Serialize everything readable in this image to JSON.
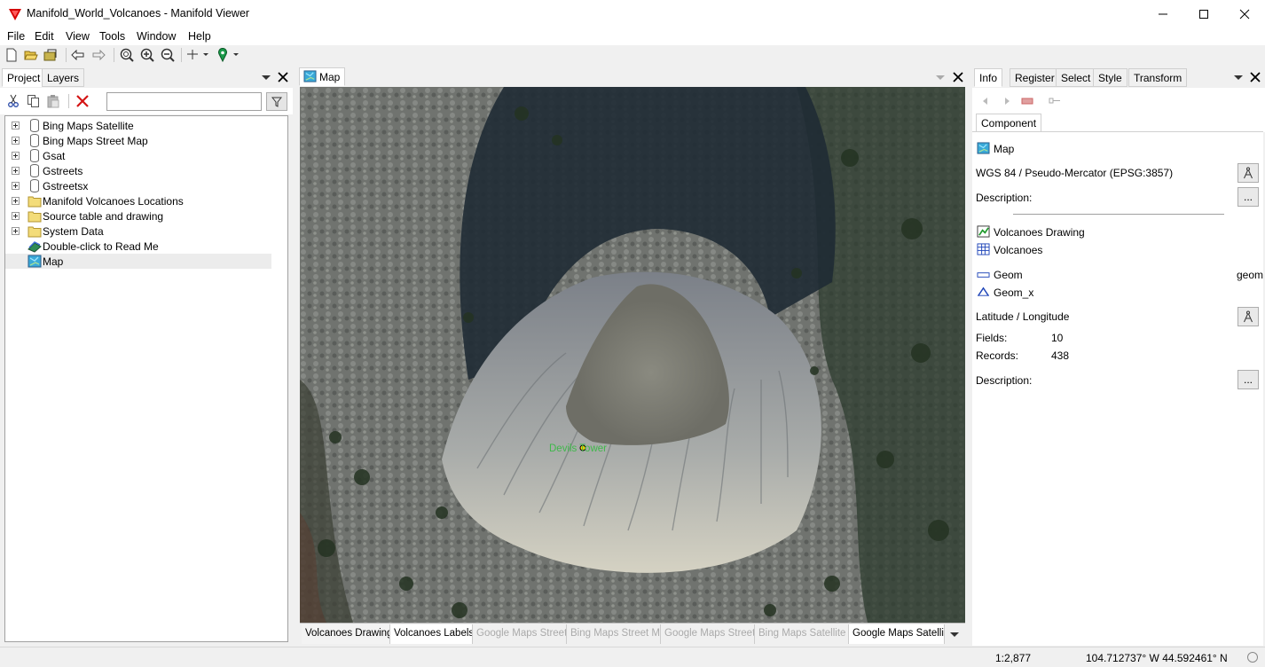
{
  "window": {
    "title": "Manifold_World_Volcanoes - Manifold Viewer",
    "accent": "#d40000"
  },
  "menu": [
    "File",
    "Edit",
    "View",
    "Tools",
    "Window",
    "Help"
  ],
  "toolbar_icons": [
    "new-icon",
    "open-icon",
    "save-icon",
    "back-icon",
    "forward-icon",
    "zoom-icon",
    "zoom-in-icon",
    "zoom-out-icon",
    "crosshair-icon",
    "locate-icon"
  ],
  "left_panel": {
    "tabs": [
      "Project",
      "Layers"
    ],
    "search_value": "",
    "tree": [
      {
        "label": "Bing Maps Satellite",
        "icon": "database-icon",
        "expandable": true
      },
      {
        "label": "Bing Maps Street Map",
        "icon": "database-icon",
        "expandable": true
      },
      {
        "label": "Gsat",
        "icon": "database-icon",
        "expandable": true
      },
      {
        "label": "Gstreets",
        "icon": "database-icon",
        "expandable": true
      },
      {
        "label": "Gstreetsx",
        "icon": "database-icon",
        "expandable": true
      },
      {
        "label": "Manifold Volcanoes Locations",
        "icon": "folder-icon",
        "expandable": true
      },
      {
        "label": "Source table and drawing",
        "icon": "folder-icon",
        "expandable": true
      },
      {
        "label": "System Data",
        "icon": "folder-icon",
        "expandable": true
      },
      {
        "label": "Double-click to Read Me",
        "icon": "comments-icon",
        "expandable": false
      },
      {
        "label": "Map",
        "icon": "map-icon",
        "expandable": false,
        "selected": true
      }
    ]
  },
  "map_window": {
    "tab": "Map",
    "feature_label": "Devils Tower",
    "layer_tabs": [
      {
        "label": "Volcanoes Drawing",
        "state": "mid"
      },
      {
        "label": "Volcanoes Labels",
        "state": "on"
      },
      {
        "label": "Google Maps Street...",
        "state": "off"
      },
      {
        "label": "Bing Maps Street M...",
        "state": "off"
      },
      {
        "label": "Google Maps Street...",
        "state": "off"
      },
      {
        "label": "Bing Maps Satellite ...",
        "state": "off"
      },
      {
        "label": "Google Maps Satelli...",
        "state": "on"
      }
    ]
  },
  "right_panel": {
    "tabs": [
      "Info",
      "Register",
      "Select",
      "Style",
      "Transform"
    ],
    "subtab": "Component",
    "component_name": "Map",
    "projection": "WGS 84 / Pseudo-Mercator (EPSG:3857)",
    "description_label": "Description:",
    "ellipsis": "...",
    "drawing_name": "Volcanoes Drawing",
    "table_name": "Volcanoes",
    "geom_label": "Geom",
    "geom_value": "geom",
    "geomx_label": "Geom_x",
    "coord_system": "Latitude / Longitude",
    "fields_label": "Fields:",
    "fields_value": "10",
    "records_label": "Records:",
    "records_value": "438",
    "description_label_2": "Description:"
  },
  "status": {
    "scale": "1:2,877",
    "coords": "104.712737° W 44.592461° N"
  }
}
